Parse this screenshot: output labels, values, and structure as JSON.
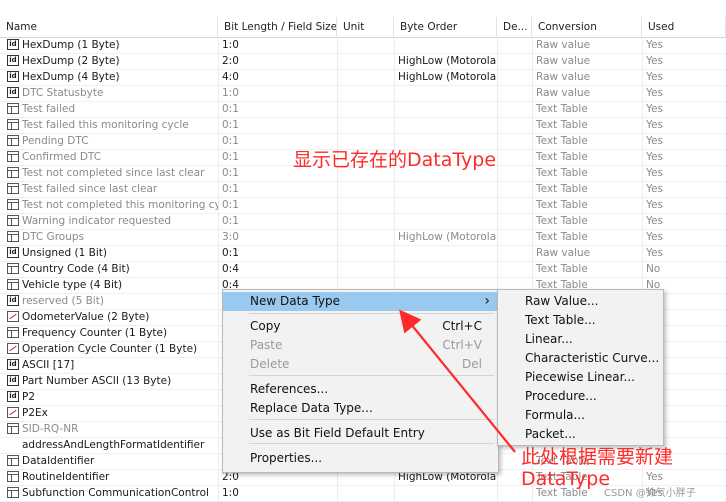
{
  "columns": [
    "Name",
    "Bit Length / Field Size",
    "Unit",
    "Byte Order",
    "De...",
    "Conversion",
    "Used"
  ],
  "rows": [
    {
      "icon": "id",
      "name": "HexDump (1 Byte)",
      "bits": "1:0",
      "order": "",
      "conv": "Raw value",
      "used": "Yes",
      "gray": false
    },
    {
      "icon": "id",
      "name": "HexDump (2 Byte)",
      "bits": "2:0",
      "order": "HighLow (Motorola)",
      "conv": "Raw value",
      "used": "Yes",
      "gray": false
    },
    {
      "icon": "id",
      "name": "HexDump (4 Byte)",
      "bits": "4:0",
      "order": "HighLow (Motorola)",
      "conv": "Raw value",
      "used": "Yes",
      "gray": false
    },
    {
      "icon": "id",
      "name": "DTC Statusbyte",
      "bits": "1:0",
      "order": "",
      "conv": "Raw value",
      "used": "Yes",
      "gray": true
    },
    {
      "icon": "tt",
      "name": "Test failed",
      "bits": "0:1",
      "order": "",
      "conv": "Text Table",
      "used": "Yes",
      "gray": true
    },
    {
      "icon": "tt",
      "name": "Test failed this monitoring cycle",
      "bits": "0:1",
      "order": "",
      "conv": "Text Table",
      "used": "Yes",
      "gray": true
    },
    {
      "icon": "tt",
      "name": "Pending DTC",
      "bits": "0:1",
      "order": "",
      "conv": "Text Table",
      "used": "Yes",
      "gray": true
    },
    {
      "icon": "tt",
      "name": "Confirmed DTC",
      "bits": "0:1",
      "order": "",
      "conv": "Text Table",
      "used": "Yes",
      "gray": true
    },
    {
      "icon": "tt",
      "name": "Test not completed since last clear",
      "bits": "0:1",
      "order": "",
      "conv": "Text Table",
      "used": "Yes",
      "gray": true
    },
    {
      "icon": "tt",
      "name": "Test failed since last clear",
      "bits": "0:1",
      "order": "",
      "conv": "Text Table",
      "used": "Yes",
      "gray": true
    },
    {
      "icon": "tt",
      "name": "Test not completed this monitoring cycle",
      "bits": "0:1",
      "order": "",
      "conv": "Text Table",
      "used": "Yes",
      "gray": true
    },
    {
      "icon": "tt",
      "name": "Warning indicator requested",
      "bits": "0:1",
      "order": "",
      "conv": "Text Table",
      "used": "Yes",
      "gray": true
    },
    {
      "icon": "tt",
      "name": "DTC Groups",
      "bits": "3:0",
      "order": "HighLow (Motorola)",
      "conv": "Text Table",
      "used": "Yes",
      "gray": true
    },
    {
      "icon": "id",
      "name": "Unsigned (1 Bit)",
      "bits": "0:1",
      "order": "",
      "conv": "Raw value",
      "used": "Yes",
      "gray": false
    },
    {
      "icon": "tt",
      "name": "Country Code (4 Bit)",
      "bits": "0:4",
      "order": "",
      "conv": "Text Table",
      "used": "No",
      "gray": false
    },
    {
      "icon": "tt",
      "name": "Vehicle type (4 Bit)",
      "bits": "0:4",
      "order": "",
      "conv": "Text Table",
      "used": "No",
      "gray": false
    },
    {
      "icon": "id",
      "name": "reserved (5 Bit)",
      "bits": "",
      "order": "",
      "conv": "",
      "used": "",
      "gray": true
    },
    {
      "icon": "curve",
      "name": "OdometerValue (2 Byte)",
      "bits": "",
      "order": "",
      "conv": "",
      "used": "",
      "gray": false
    },
    {
      "icon": "tt",
      "name": "Frequency Counter (1 Byte)",
      "bits": "",
      "order": "",
      "conv": "",
      "used": "",
      "gray": false
    },
    {
      "icon": "curve",
      "name": "Operation Cycle Counter (1 Byte)",
      "bits": "",
      "order": "",
      "conv": "",
      "used": "",
      "gray": false
    },
    {
      "icon": "id",
      "name": "ASCII [17]",
      "bits": "",
      "order": "",
      "conv": "",
      "used": "",
      "gray": false
    },
    {
      "icon": "id",
      "name": "Part Number ASCII (13 Byte)",
      "bits": "",
      "order": "",
      "conv": "",
      "used": "",
      "gray": false
    },
    {
      "icon": "id",
      "name": "P2",
      "bits": "",
      "order": "",
      "conv": "",
      "used": "",
      "gray": false
    },
    {
      "icon": "curve",
      "name": "P2Ex",
      "bits": "",
      "order": "",
      "conv": "",
      "used": "",
      "gray": false
    },
    {
      "icon": "tt",
      "name": "SID-RQ-NR",
      "bits": "",
      "order": "",
      "conv": "",
      "used": "",
      "gray": true
    },
    {
      "icon": "",
      "name": "addressAndLengthFormatIdentifier",
      "bits": "",
      "order": "",
      "conv": "",
      "used": "",
      "gray": false
    },
    {
      "icon": "tt",
      "name": "DataIdentifier",
      "bits": "",
      "order": "",
      "conv": "Text Table",
      "used": "",
      "gray": false
    },
    {
      "icon": "tt",
      "name": "RoutineIdentifier",
      "bits": "2:0",
      "order": "HighLow (Motorola)",
      "conv": "Text Table",
      "used": "Yes",
      "gray": false
    },
    {
      "icon": "tt",
      "name": "Subfunction CommunicationControl",
      "bits": "1:0",
      "order": "",
      "conv": "Text Table",
      "used": "Yes",
      "gray": false
    }
  ],
  "context_menu": {
    "items": [
      {
        "label": "New Data Type",
        "shortcut": "",
        "submenu": true,
        "disabled": false,
        "highlight": true
      },
      {
        "label": "Copy",
        "shortcut": "Ctrl+C",
        "submenu": false,
        "disabled": false,
        "highlight": false
      },
      {
        "label": "Paste",
        "shortcut": "Ctrl+V",
        "submenu": false,
        "disabled": true,
        "highlight": false
      },
      {
        "label": "Delete",
        "shortcut": "Del",
        "submenu": false,
        "disabled": true,
        "highlight": false
      },
      {
        "label": "References...",
        "shortcut": "",
        "submenu": false,
        "disabled": false,
        "highlight": false
      },
      {
        "label": "Replace Data Type...",
        "shortcut": "",
        "submenu": false,
        "disabled": false,
        "highlight": false
      },
      {
        "label": "Use as Bit Field Default Entry",
        "shortcut": "",
        "submenu": false,
        "disabled": false,
        "highlight": false
      },
      {
        "label": "Properties...",
        "shortcut": "",
        "submenu": false,
        "disabled": false,
        "highlight": false
      }
    ],
    "submenu_arrow": "›"
  },
  "submenu": {
    "items": [
      "Raw Value...",
      "Text Table...",
      "Linear...",
      "Characteristic Curve...",
      "Piecewise Linear...",
      "Procedure...",
      "Formula...",
      "Packet..."
    ]
  },
  "annotations": {
    "existing": "显示已存在的DataType",
    "new_line1": "此处根据需要新建",
    "new_line2": "DataType",
    "watermark": "CSDN @帅气小胖子"
  },
  "colors": {
    "annotation": "#ff2a2a",
    "menu_highlight": "#99c9ef"
  }
}
